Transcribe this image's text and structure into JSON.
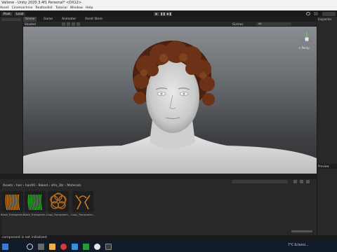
{
  "window": {
    "title": "Vallone - Unity 2020.3.4f1 Personal* <DX12>"
  },
  "menu": [
    "Asset",
    "Cinemachine",
    "Realtoolkit",
    "Tutorial",
    "Window",
    "Help"
  ],
  "toolbar": {
    "left_buttons": [
      "Pivot",
      "Local"
    ],
    "play_glyphs": [
      "▶",
      "❚❚",
      "▶❚"
    ]
  },
  "scene_tabs": [
    "Scene",
    "Game",
    "Animator",
    "Asset Store"
  ],
  "scene_tools": {
    "shading": "Shaded",
    "gizmos": "Gizmos",
    "search": "All"
  },
  "gizmo": {
    "label": "< Persp"
  },
  "right_panel": {
    "title": "Inspector",
    "preview": "Preview"
  },
  "project": {
    "breadcrumb": [
      "Assets",
      "hair",
      "hair00",
      "Baked",
      "afro_3br",
      "Materials"
    ],
    "materials": [
      {
        "label": "Black_Transparen...",
        "color": "#d98a1a",
        "style": "strands"
      },
      {
        "label": "Black_Transparen...",
        "color": "#2fbf2f",
        "style": "strands"
      },
      {
        "label": "Copy_Transparen...",
        "color": "#b86a20",
        "style": "curly"
      },
      {
        "label": "Copy_Transparen...",
        "color": "#c97a2a",
        "style": "ears"
      }
    ]
  },
  "status": {
    "text": "component is not initialized"
  },
  "taskbar": {
    "weather_temp": "7°C",
    "weather_desc": "Eclairci..."
  },
  "colors": {
    "accent": "#3a7bd5",
    "hair": "#5a2a14"
  }
}
